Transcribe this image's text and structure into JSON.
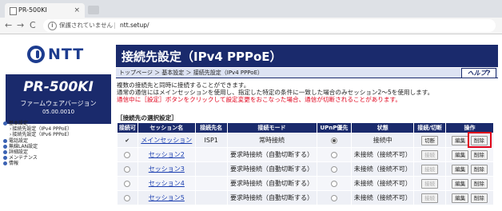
{
  "browser": {
    "tab_title": "PR-500KI",
    "tab_close": "×",
    "nav_back": "←",
    "nav_forward": "→",
    "nav_reload": "C",
    "security_icon": "i",
    "security_text": "保護されていません",
    "separator": "|",
    "url": "ntt.setup/"
  },
  "sidebar": {
    "logo_text": "NTT",
    "model": "PR-500KI",
    "firmware_label": "ファームウェアバージョン",
    "firmware_version": "05.00.0010",
    "menu": [
      {
        "label": "基本設定",
        "level": 0
      },
      {
        "label": "接続先設定（IPv4 PPPoE）",
        "level": 1
      },
      {
        "label": "接続先設定（IPv6 PPPoE）",
        "level": 1
      },
      {
        "label": "電話設定",
        "level": 0
      },
      {
        "label": "無線LAN設定",
        "level": 0
      },
      {
        "label": "詳細設定",
        "level": 0
      },
      {
        "label": "メンテナンス",
        "level": 0
      },
      {
        "label": "情報",
        "level": 0
      }
    ]
  },
  "main": {
    "title": "接続先設定（IPv4 PPPoE）",
    "breadcrumb": "トップページ ＞ 基本設定 ＞ 接続先設定（IPv4 PPPoE）",
    "help_label": "ヘルプ?",
    "desc_line1": "複数の接続先と同時に接続することができます。",
    "desc_line2": "通常の通信にはメインセッションを使用し、指定した特定の条件に一致した場合のみセッション2〜5を使用します。",
    "desc_warn": "通信中に［設定］ボタンをクリックして設定変更をおこなった場合、通信が切断されることがあります。",
    "section_title": "［接続先の選択設定］"
  },
  "table": {
    "headers": [
      "接続可",
      "セッション名",
      "接続先名",
      "接続モード",
      "UPnP優先",
      "状態",
      "接続/切断",
      "操作"
    ],
    "rows": [
      {
        "enabled": "✔",
        "name": "メインセッション",
        "dest": "ISP1",
        "mode": "常時接続",
        "upnp_selected": true,
        "status": "接続中",
        "conn_btn": "切断",
        "conn_enabled": true,
        "edit": "編集",
        "delete": "削除"
      },
      {
        "enabled": "",
        "name": "セッション2",
        "dest": "",
        "mode": "要求時接続（自動切断する）",
        "upnp_selected": false,
        "status": "未接続（接続不可）",
        "conn_btn": "接続",
        "conn_enabled": false,
        "edit": "編集",
        "delete": "削除"
      },
      {
        "enabled": "",
        "name": "セッション3",
        "dest": "",
        "mode": "要求時接続（自動切断する）",
        "upnp_selected": false,
        "status": "未接続（接続不可）",
        "conn_btn": "接続",
        "conn_enabled": false,
        "edit": "編集",
        "delete": "削除"
      },
      {
        "enabled": "",
        "name": "セッション4",
        "dest": "",
        "mode": "要求時接続（自動切断する）",
        "upnp_selected": false,
        "status": "未接続（接続不可）",
        "conn_btn": "接続",
        "conn_enabled": false,
        "edit": "編集",
        "delete": "削除"
      },
      {
        "enabled": "",
        "name": "セッション5",
        "dest": "",
        "mode": "要求時接続（自動切断する）",
        "upnp_selected": false,
        "status": "未接続（接続不可）",
        "conn_btn": "接続",
        "conn_enabled": false,
        "edit": "編集",
        "delete": "削除"
      }
    ]
  },
  "colors": {
    "brand_navy": "#1a2a6c",
    "warning_red": "#e0001a",
    "link_blue": "#1a3eb0"
  }
}
